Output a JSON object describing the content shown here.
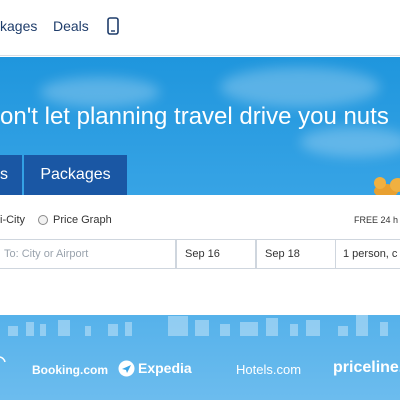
{
  "nav": {
    "packages_label": "kages",
    "deals_label": "Deals",
    "phone_icon": "phone-icon"
  },
  "hero": {
    "headline": "on't let planning travel drive you nuts",
    "tabs": [
      {
        "label": "s"
      },
      {
        "label": "Packages"
      }
    ],
    "bg_color": "#3aa5e6",
    "tab_color": "#1a57a4"
  },
  "search": {
    "options": {
      "multi_city_label": "i-City",
      "price_graph_label": "Price Graph"
    },
    "free_note": "FREE 24 h",
    "to_placeholder": "To: City or Airport",
    "depart_date": "Sep 16",
    "return_date": "Sep 18",
    "travelers": "1 person, c"
  },
  "partners": {
    "booking": "Booking.com",
    "expedia": "Expedia",
    "hotels": "Hotels.com",
    "priceline": "priceline."
  }
}
